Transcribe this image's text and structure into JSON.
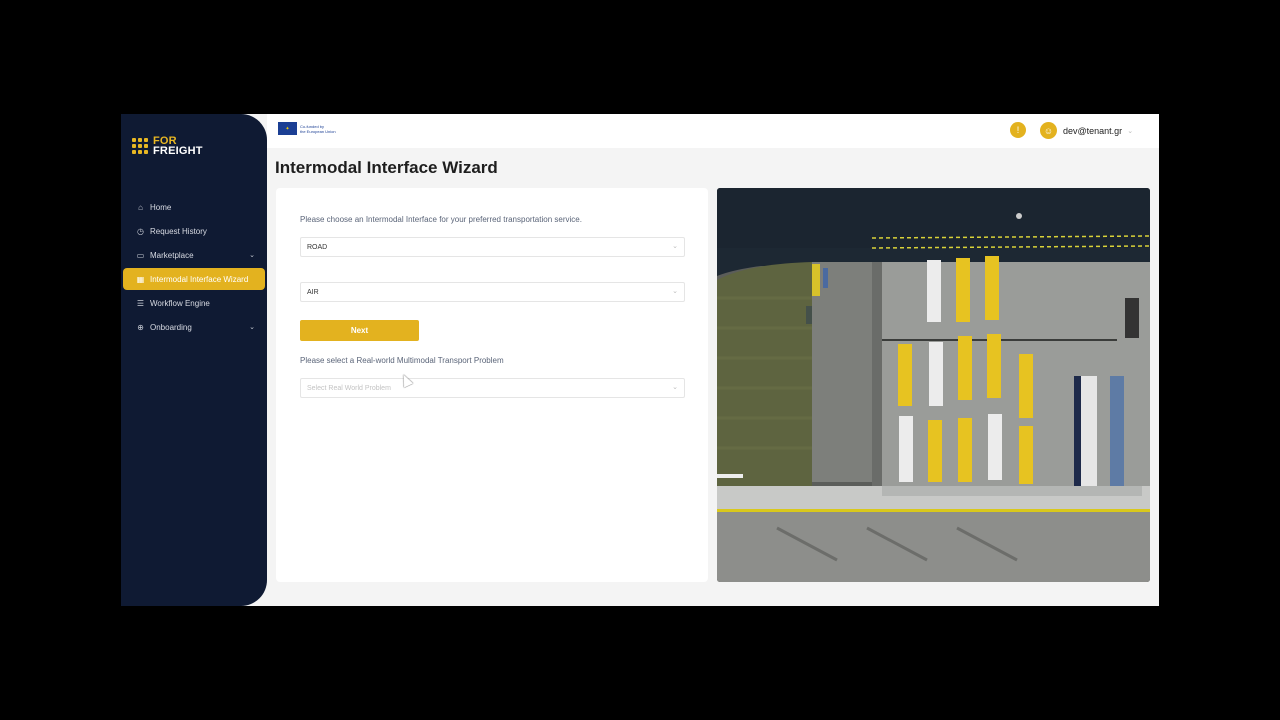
{
  "brand": {
    "line1": "FOR",
    "line2": "FREIGHT",
    "accent": "#e3b21f",
    "sidebar_bg": "#0f1a33"
  },
  "eu": {
    "line1": "Co-funded by",
    "line2": "the European Union"
  },
  "sidebar": {
    "items": [
      {
        "label": "Home",
        "icon": "home-icon",
        "active": false,
        "expandable": false
      },
      {
        "label": "Request History",
        "icon": "history-icon",
        "active": false,
        "expandable": false
      },
      {
        "label": "Marketplace",
        "icon": "marketplace-icon",
        "active": false,
        "expandable": true
      },
      {
        "label": "Intermodal Interface Wizard",
        "icon": "table-icon",
        "active": true,
        "expandable": false
      },
      {
        "label": "Workflow Engine",
        "icon": "list-icon",
        "active": false,
        "expandable": false
      },
      {
        "label": "Onboarding",
        "icon": "onboarding-icon",
        "active": false,
        "expandable": true
      }
    ]
  },
  "header": {
    "user_email": "dev@tenant.gr"
  },
  "page": {
    "title": "Intermodal Interface Wizard"
  },
  "wizard": {
    "prompt_interface": "Please choose an Intermodal Interface for your preferred transportation service.",
    "select_from_value": "ROAD",
    "select_to_value": "AIR",
    "next_label": "Next",
    "prompt_problem": "Please select a Real-world Multimodal Transport Problem",
    "problem_placeholder": "Select Real World Problem"
  },
  "hero_image": {
    "description_icon": "aerial-port-photo"
  }
}
